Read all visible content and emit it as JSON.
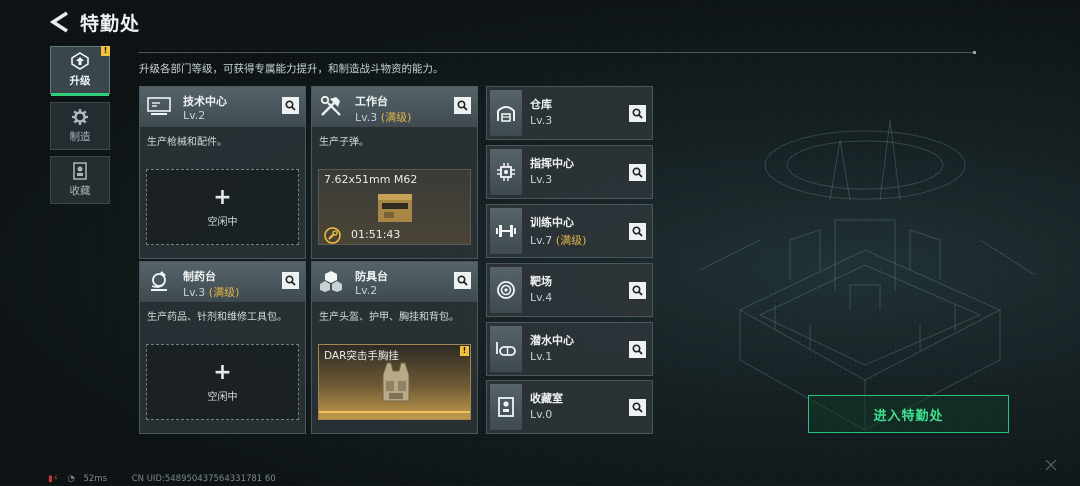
{
  "header": {
    "title": "特勤处",
    "subtitle": "升级各部门等级，可获得专属能力提升，和制造战斗物资的能力。"
  },
  "side_tabs": [
    {
      "label": "升级",
      "active": true,
      "warn": "!"
    },
    {
      "label": "制造",
      "active": false
    },
    {
      "label": "收藏",
      "active": false
    }
  ],
  "stations": [
    {
      "name": "技术中心",
      "level": "Lv.2",
      "maxed": "",
      "desc": "生产枪械和配件。",
      "slot": {
        "type": "idle",
        "plus": "+",
        "label": "空闲中"
      }
    },
    {
      "name": "工作台",
      "level": "Lv.3",
      "maxed": "(满级)",
      "desc": "生产子弹。",
      "slot": {
        "type": "job",
        "item": "7.62x51mm M62",
        "timer": "01:51:43"
      }
    },
    {
      "name": "制药台",
      "level": "Lv.3",
      "maxed": "(满级)",
      "desc": "生产药品、针剂和维修工具包。",
      "slot": {
        "type": "idle",
        "plus": "+",
        "label": "空闲中"
      }
    },
    {
      "name": "防具台",
      "level": "Lv.2",
      "maxed": "",
      "desc": "生产头盔、护甲、胸挂和背包。",
      "slot": {
        "type": "done",
        "item": "DAR突击手胸挂",
        "warn": "!"
      }
    }
  ],
  "facilities": [
    {
      "name": "仓库",
      "level": "Lv.3",
      "maxed": ""
    },
    {
      "name": "指挥中心",
      "level": "Lv.3",
      "maxed": ""
    },
    {
      "name": "训练中心",
      "level": "Lv.7",
      "maxed": "(满级)"
    },
    {
      "name": "靶场",
      "level": "Lv.4",
      "maxed": ""
    },
    {
      "name": "潜水中心",
      "level": "Lv.1",
      "maxed": ""
    },
    {
      "name": "收藏室",
      "level": "Lv.0",
      "maxed": ""
    }
  ],
  "enter_button": "进入特勤处",
  "footer": {
    "ping": "52ms",
    "uid": "CN UID:548950437564331781 60"
  },
  "colors": {
    "accent_green": "#2fcf7e",
    "maxed_gold": "#e2b447",
    "warn_yellow": "#f2c33a"
  },
  "icons": {
    "back": "back-arrow-icon",
    "search": "search-icon",
    "upgrade": "upgrade-icon",
    "craft": "gear-icon",
    "collection": "trophy-icon"
  }
}
